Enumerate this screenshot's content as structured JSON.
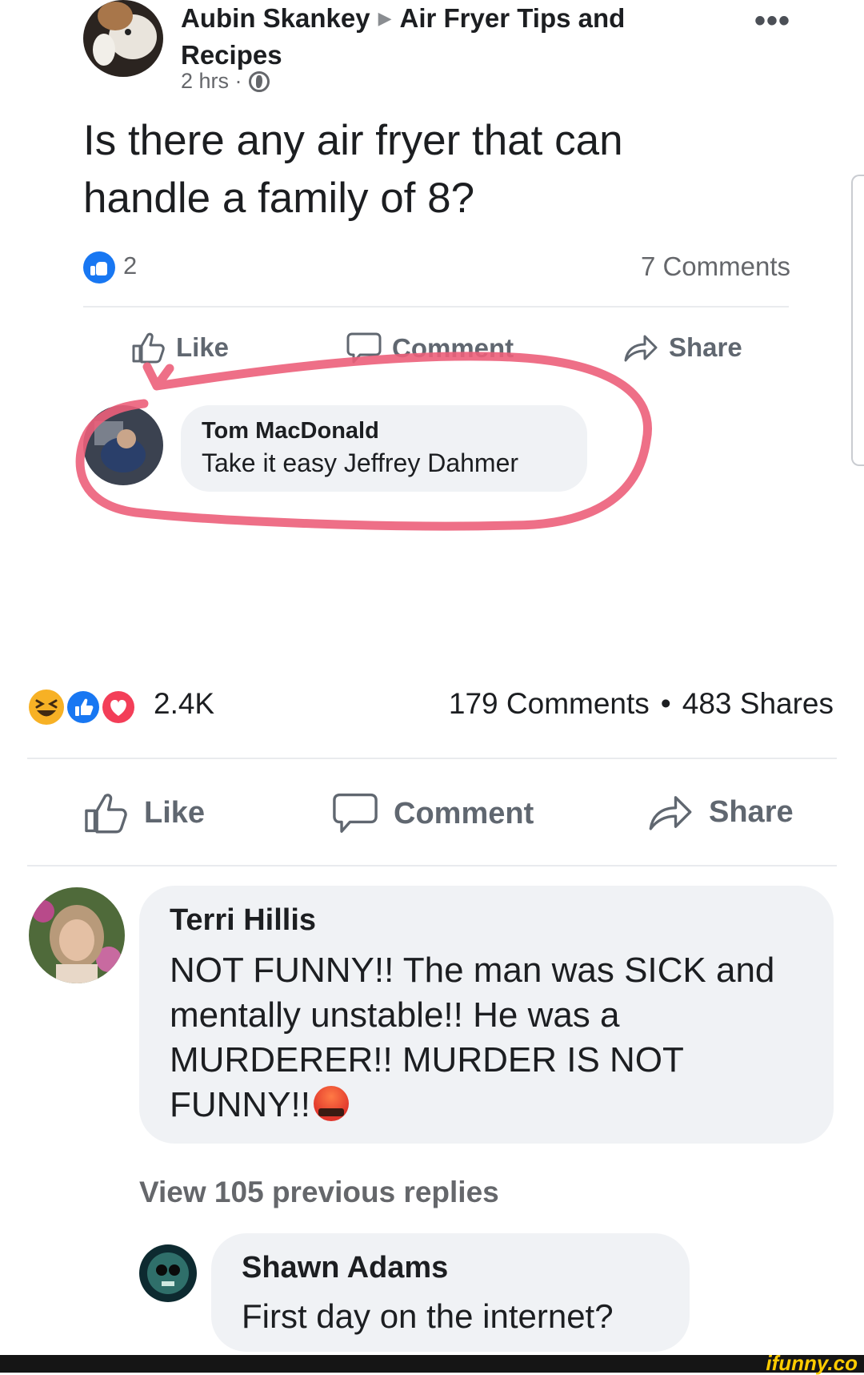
{
  "embedded_post": {
    "author": "Aubin Skankey",
    "group": "Air Fryer Tips and Recipes",
    "time": "2 hrs ·",
    "text": "Is there any air fryer that can handle a family of 8?",
    "reaction_count": "2",
    "comments_count": "7 Comments",
    "actions": {
      "like": "Like",
      "comment": "Comment",
      "share": "Share"
    },
    "comment": {
      "author": "Tom MacDonald",
      "text": "Take it easy Jeffrey Dahmer"
    }
  },
  "post": {
    "reaction_count": "2.4K",
    "comments_count": "179 Comments",
    "separator": "•",
    "shares_count": "483 Shares",
    "actions": {
      "like": "Like",
      "comment": "Comment",
      "share": "Share"
    }
  },
  "comments": [
    {
      "author": "Terri Hillis",
      "text": "NOT FUNNY!! The man was SICK and mentally unstable!! He was a MURDERER!! MURDER IS NOT FUNNY!!"
    }
  ],
  "view_replies": "View 105 previous replies",
  "reply": {
    "author": "Shawn Adams",
    "text": "First day on the internet?"
  },
  "watermark": "ifunny.co",
  "colors": {
    "highlight_circle": "#ec5f7a",
    "facebook_blue": "#1877f2",
    "love_red": "#f33e58",
    "haha_yellow": "#f7b125"
  },
  "icons": [
    "ellipsis-icon",
    "globe-icon",
    "like-reaction-icon",
    "thumbs-up-icon",
    "comment-icon",
    "share-icon",
    "haha-reaction-icon",
    "love-reaction-icon",
    "angry-emoji-icon"
  ]
}
